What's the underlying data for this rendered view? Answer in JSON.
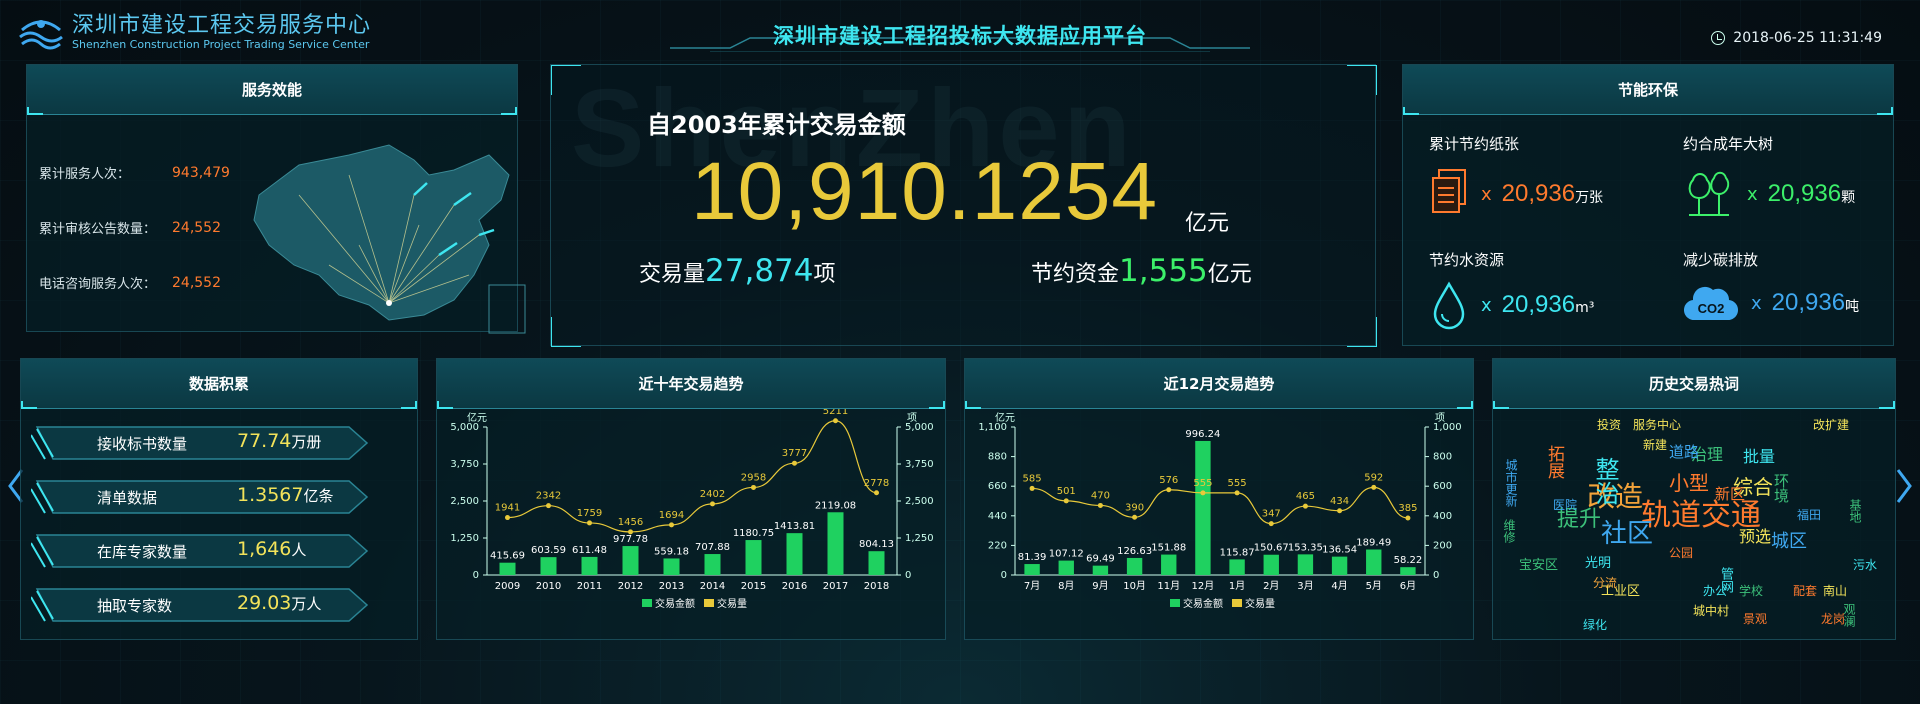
{
  "header": {
    "logo_cn": "深圳市建设工程交易服务中心",
    "logo_en": "Shenzhen Construction Project Trading Service Center",
    "title": "深圳市建设工程招投标大数据应用平台",
    "datetime": "2018-06-25 11:31:49"
  },
  "service": {
    "title": "服务效能",
    "rows": [
      {
        "label": "累计服务人次：",
        "value": "943,479"
      },
      {
        "label": "累计审核公告数量：",
        "value": "24,552"
      },
      {
        "label": "电话咨询服务人次：",
        "value": "24,552"
      }
    ]
  },
  "summary": {
    "background_word": "ShenZhen",
    "label": "自2003年累计交易金额",
    "amount": "10,910.1254",
    "amount_unit": "亿元",
    "volume_label": "交易量",
    "volume_value": "27,874",
    "volume_unit": "项",
    "savings_label": "节约资金",
    "savings_value": "1,555",
    "savings_unit": "亿元"
  },
  "eco": {
    "title": "节能环保",
    "items": [
      {
        "title": "累计节约纸张",
        "value": "20,936",
        "unit": "万张",
        "color": "#ff7a2e",
        "icon": "paper-icon"
      },
      {
        "title": "约合成年大树",
        "value": "20,936",
        "unit": "颗",
        "color": "#3cf06a",
        "icon": "tree-icon"
      },
      {
        "title": "节约水资源",
        "value": "20,936",
        "unit": "m³",
        "color": "#3ee6f0",
        "icon": "water-drop-icon"
      },
      {
        "title": "减少碳排放",
        "value": "20,936",
        "unit": "吨",
        "color": "#3fa8f0",
        "icon": "co2-cloud-icon"
      }
    ],
    "x": "x"
  },
  "accumulation": {
    "title": "数据积累",
    "items": [
      {
        "label": "接收标书数量",
        "value": "77.74",
        "unit": "万册"
      },
      {
        "label": "清单数据",
        "value": "1.3567",
        "unit": "亿条"
      },
      {
        "label": "在库专家数量",
        "value": "1,646",
        "unit": "人"
      },
      {
        "label": "抽取专家数",
        "value": "29.03",
        "unit": "万人"
      }
    ]
  },
  "trend10": {
    "title": "近十年交易趋势"
  },
  "trend12": {
    "title": "近12月交易趋势"
  },
  "wordcloud": {
    "title": "历史交易热词",
    "words": [
      {
        "text": "轨道交通",
        "color": "#ff7a2e",
        "size": 30
      },
      {
        "text": "改造",
        "color": "#f3a33a",
        "size": 28
      },
      {
        "text": "社区",
        "color": "#3fa8f0",
        "size": 26
      },
      {
        "text": "整治",
        "color": "#3ee6f0",
        "size": 24
      },
      {
        "text": "提升",
        "color": "#3cc07a",
        "size": 22
      },
      {
        "text": "小型",
        "color": "#ff7a2e",
        "size": 20
      },
      {
        "text": "综合",
        "color": "#f3e35a",
        "size": 20
      },
      {
        "text": "城区",
        "color": "#3fa8f0",
        "size": 18
      },
      {
        "text": "拓展",
        "color": "#ff7a2e",
        "size": 17
      },
      {
        "text": "预选",
        "color": "#f3e35a",
        "size": 16
      },
      {
        "text": "批量",
        "color": "#3ee6f0",
        "size": 16
      },
      {
        "text": "治理",
        "color": "#3cc07a",
        "size": 16
      },
      {
        "text": "道路",
        "color": "#3fa8f0",
        "size": 15
      },
      {
        "text": "环境",
        "color": "#3cc07a",
        "size": 15
      },
      {
        "text": "新区",
        "color": "#ff7a2e",
        "size": 15
      },
      {
        "text": "投资",
        "color": "#f3e35a",
        "size": 12
      },
      {
        "text": "服务中心",
        "color": "#f3e35a",
        "size": 12
      },
      {
        "text": "改扩建",
        "color": "#f3e35a",
        "size": 12
      },
      {
        "text": "城市更新",
        "color": "#3fa8f0",
        "size": 12
      },
      {
        "text": "光明",
        "color": "#3ee6f0",
        "size": 13
      },
      {
        "text": "宝安区",
        "color": "#3cc07a",
        "size": 13
      },
      {
        "text": "工业区",
        "color": "#f3e35a",
        "size": 13
      },
      {
        "text": "公园",
        "color": "#ff7a2e",
        "size": 12
      },
      {
        "text": "管网",
        "color": "#3ee6f0",
        "size": 13
      },
      {
        "text": "学校",
        "color": "#3cc07a",
        "size": 12
      },
      {
        "text": "城中村",
        "color": "#f3e35a",
        "size": 12
      },
      {
        "text": "景观",
        "color": "#ff7a2e",
        "size": 12
      },
      {
        "text": "污水",
        "color": "#3ee6f0",
        "size": 12
      },
      {
        "text": "基地",
        "color": "#3cc07a",
        "size": 12
      },
      {
        "text": "福田",
        "color": "#3fa8f0",
        "size": 12
      },
      {
        "text": "龙岗",
        "color": "#ff7a2e",
        "size": 12
      },
      {
        "text": "南山",
        "color": "#f3e35a",
        "size": 12
      },
      {
        "text": "办公",
        "color": "#3ee6f0",
        "size": 12
      },
      {
        "text": "维修",
        "color": "#3cc07a",
        "size": 12
      },
      {
        "text": "分流",
        "color": "#f3a33a",
        "size": 12
      },
      {
        "text": "医院",
        "color": "#3fa8f0",
        "size": 12
      },
      {
        "text": "新建",
        "color": "#f3e35a",
        "size": 12
      },
      {
        "text": "配套",
        "color": "#ff7a2e",
        "size": 12
      },
      {
        "text": "观澜",
        "color": "#3cc07a",
        "size": 12
      },
      {
        "text": "绿化",
        "color": "#3ee6f0",
        "size": 12
      }
    ]
  },
  "chart_data": [
    {
      "type": "bar",
      "title": "近十年交易趋势",
      "categories": [
        "2009",
        "2010",
        "2011",
        "2012",
        "2013",
        "2014",
        "2015",
        "2016",
        "2017",
        "2018"
      ],
      "series": [
        {
          "name": "交易金额",
          "values": [
            415.69,
            603.59,
            611.48,
            977.78,
            559.18,
            707.88,
            1180.75,
            1413.81,
            2119.08,
            804.13
          ],
          "color": "#1fd160",
          "axis": "left"
        },
        {
          "name": "交易量",
          "type": "line",
          "values": [
            1941,
            2342,
            1759,
            1456,
            1694,
            2402,
            2958,
            3777,
            5211,
            2778
          ],
          "color": "#e8c93a",
          "axis": "right"
        }
      ],
      "ylabel": "亿元",
      "y2label": "项",
      "ylim": [
        0,
        5000
      ],
      "y2lim": [
        0,
        5000
      ],
      "yticks": [
        "5,000",
        "3,750",
        "2,500",
        "1,250",
        "0"
      ],
      "y2ticks": [
        "5,000",
        "3,750",
        "2,500",
        "1,250",
        "0"
      ],
      "legend": "bottom-center"
    },
    {
      "type": "bar",
      "title": "近12月交易趋势",
      "categories": [
        "7月",
        "8月",
        "9月",
        "10月",
        "11月",
        "12月",
        "1月",
        "2月",
        "3月",
        "4月",
        "5月",
        "6月"
      ],
      "series": [
        {
          "name": "交易金额",
          "values": [
            81.39,
            107.12,
            69.49,
            126.63,
            151.88,
            996.24,
            115.87,
            150.67,
            153.35,
            136.54,
            189.49,
            58.22
          ],
          "color": "#1fd160",
          "axis": "left"
        },
        {
          "name": "交易量",
          "type": "line",
          "values": [
            585,
            501,
            470,
            390,
            576,
            555,
            555,
            347,
            465,
            434,
            592,
            385
          ],
          "color": "#e8c93a",
          "axis": "right"
        }
      ],
      "ylabel": "亿元",
      "y2label": "项",
      "ylim": [
        0,
        1100
      ],
      "y2lim": [
        0,
        1000
      ],
      "yticks": [
        "1,100",
        "880",
        "660",
        "440",
        "220",
        "0"
      ],
      "y2ticks": [
        "1,000",
        "800",
        "600",
        "400",
        "200",
        "0"
      ],
      "legend": "bottom-center"
    }
  ]
}
